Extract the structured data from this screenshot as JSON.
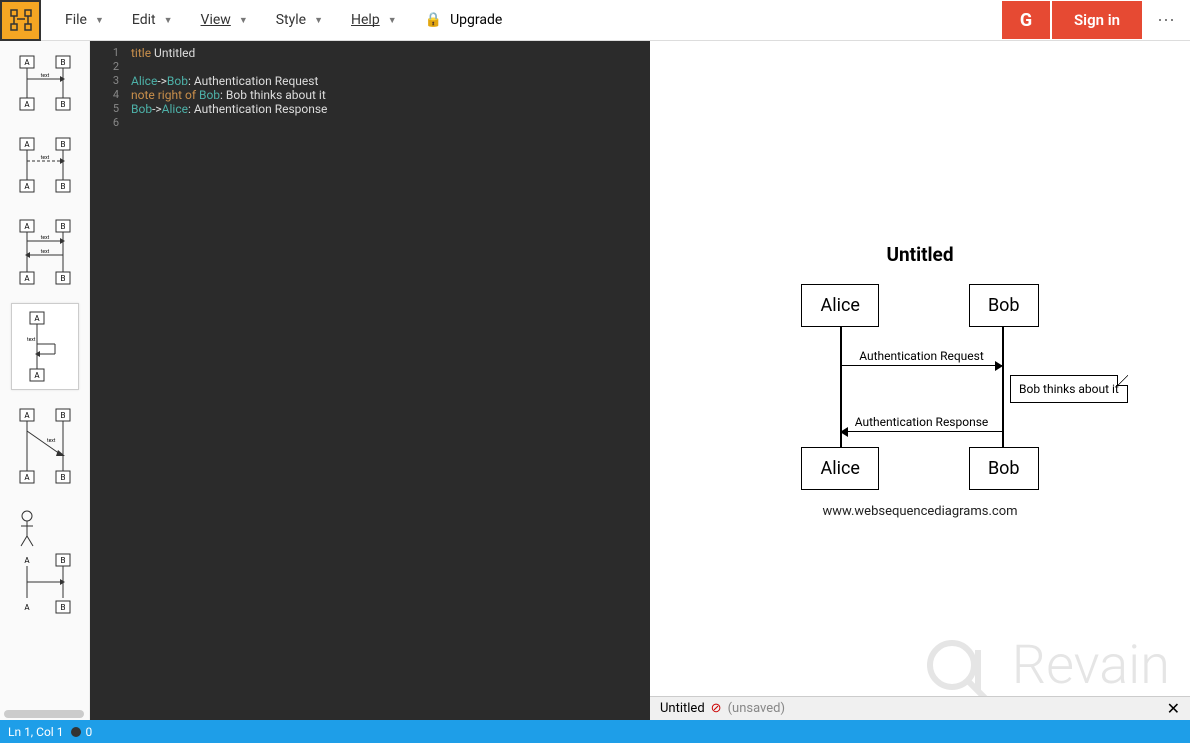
{
  "menu": {
    "file": "File",
    "edit": "Edit",
    "view": "View",
    "style": "Style",
    "help": "Help",
    "upgrade": "Upgrade"
  },
  "auth": {
    "google": "G",
    "signin": "Sign in"
  },
  "editor": {
    "lines": [
      "1",
      "2",
      "3",
      "4",
      "5",
      "6"
    ],
    "code": {
      "l1_kw": "title",
      "l1_rest": " Untitled",
      "l3_a1": "Alice",
      "l3_arrow": "->",
      "l3_a2": "Bob",
      "l3_rest": ": Authentication Request",
      "l4_kw": "note right of ",
      "l4_a": "Bob",
      "l4_rest": ": Bob thinks about it",
      "l5_a1": "Bob",
      "l5_arrow": "->",
      "l5_a2": "Alice",
      "l5_rest": ": Authentication Response"
    }
  },
  "diagram": {
    "title": "Untitled",
    "actor1": "Alice",
    "actor2": "Bob",
    "msg1": "Authentication Request",
    "note": "Bob thinks about it",
    "msg2": "Authentication Response",
    "credit": "www.websequencediagrams.com"
  },
  "status": {
    "filename": "Untitled",
    "unsaved": "(unsaved)",
    "pos": "Ln 1, Col 1",
    "errors": "0"
  },
  "watermark": "Revain"
}
